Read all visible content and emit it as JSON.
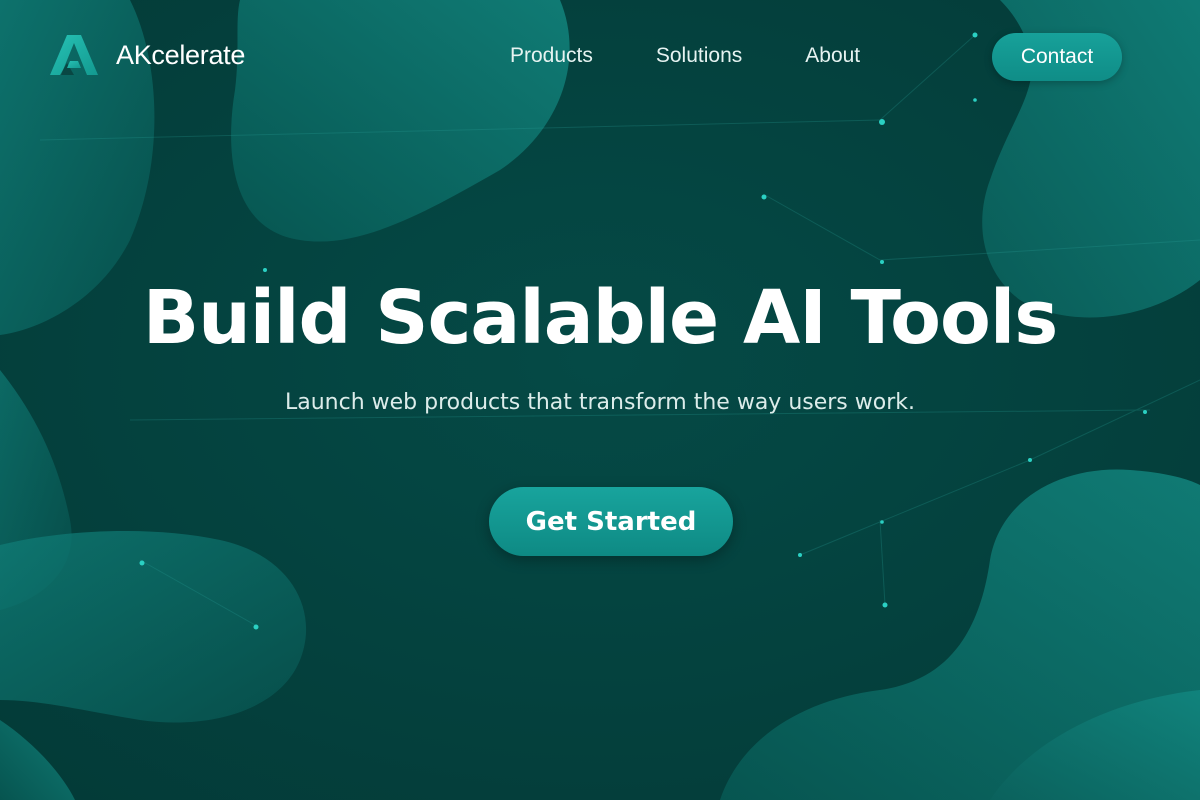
{
  "brand": {
    "name": "AKcelerate",
    "logo_icon": "triangle-a-logo-icon"
  },
  "nav": {
    "links": [
      {
        "label": "Products"
      },
      {
        "label": "Solutions"
      },
      {
        "label": "About"
      }
    ],
    "contact_label": "Contact"
  },
  "hero": {
    "title": "Build Scalable AI Tools",
    "subtitle": "Launch web products that transform the way users work.",
    "cta_label": "Get Started"
  },
  "colors": {
    "background": "#05403d",
    "accent": "#13968f",
    "blob": "#0b6a65",
    "text": "#ffffff"
  }
}
